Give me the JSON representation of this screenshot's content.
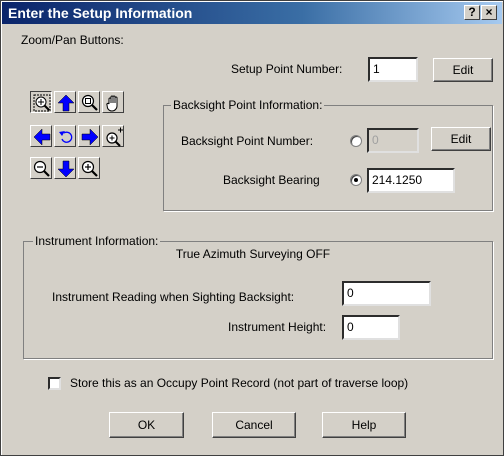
{
  "window": {
    "title": "Enter the Setup Information",
    "help_glyph": "?",
    "close_glyph": "×"
  },
  "zoom_pan": {
    "label": "Zoom/Pan Buttons:",
    "buttons": [
      "zoom-extents-icon",
      "pan-up-icon",
      "zoom-window-icon",
      "hand-pan-icon",
      "pan-left-icon",
      "undo-view-icon",
      "pan-right-icon",
      "zoom-in-plus-icon",
      "zoom-out-icon",
      "pan-down-icon",
      "zoom-in-icon"
    ]
  },
  "setup_point": {
    "label": "Setup Point Number:",
    "value": "1",
    "edit_label": "Edit"
  },
  "backsight": {
    "group_label": "Backsight Point Information:",
    "point_label": "Backsight Point Number:",
    "point_value": "0",
    "point_selected": false,
    "edit_label": "Edit",
    "bearing_label": "Backsight Bearing",
    "bearing_value": "214.1250",
    "bearing_selected": true
  },
  "instrument": {
    "group_label": "Instrument Information:",
    "status": "True Azimuth Surveying OFF",
    "reading_label": "Instrument Reading when Sighting Backsight:",
    "reading_value": "0",
    "height_label": "Instrument Height:",
    "height_value": "0"
  },
  "occupy": {
    "label": "Store this as an Occupy Point Record (not part of traverse loop)",
    "checked": false
  },
  "buttons": {
    "ok": "OK",
    "cancel": "Cancel",
    "help": "Help"
  },
  "colors": {
    "title_bar": "#0a246a",
    "arrow_blue": "#0000ff",
    "face": "#d4d0c8"
  }
}
